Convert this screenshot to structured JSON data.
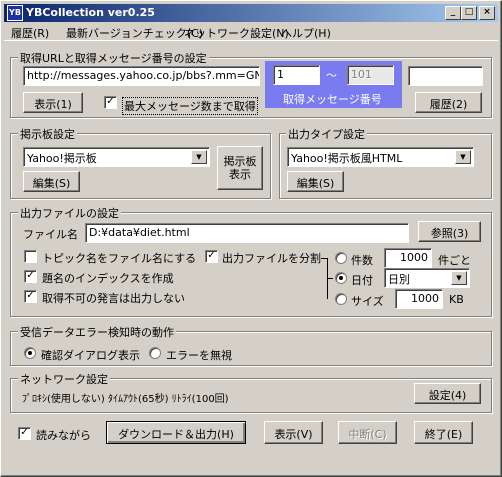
{
  "window": {
    "title": "YBCollection ver0.25",
    "icon_text": "YB"
  },
  "caption_buttons": {
    "minimize": "_",
    "maximize": "□",
    "close": "×"
  },
  "menu": [
    "履歴(R)",
    "最新バージョンチェック(C)",
    "ネットワーク設定(N)",
    "ヘルプ(H)"
  ],
  "url_group": {
    "label": "取得URLと取得メッセージ番号の設定",
    "url": "http://messages.yahoo.co.jp/bbs?.mm=GN&ac",
    "from": "1",
    "tilde": "～",
    "to": "101",
    "range_caption": "取得メッセージ番号",
    "extra": "",
    "show_button": "表示(1)",
    "max_checkbox": "最大メッセージ数まで取得",
    "history_button": "履歴(2)"
  },
  "board_group": {
    "label": "掲示板設定",
    "selected": "Yahoo!掲示板",
    "edit_button": "編集(S)",
    "show_button_line1": "掲示板",
    "show_button_line2": "表示"
  },
  "output_type_group": {
    "label": "出力タイプ設定",
    "selected": "Yahoo!掲示板風HTML",
    "edit_button": "編集(S)"
  },
  "output_file_group": {
    "label": "出力ファイルの設定",
    "filename_label": "ファイル名",
    "filename": "D:¥data¥diet.html",
    "browse_button": "参照(3)",
    "topic_checkbox": "トピック名をファイル名にする",
    "split_checkbox": "出力ファイルを分割",
    "index_checkbox": "題名のインデックスを作成",
    "skip_checkbox": "取得不可の発言は出力しない",
    "count_radio": "件数",
    "count_value": "1000",
    "count_unit": "件ごと",
    "date_radio": "日付",
    "date_selected": "日別",
    "size_radio": "サイズ",
    "size_value": "1000",
    "size_unit": "KB"
  },
  "error_group": {
    "label": "受信データエラー検知時の動作",
    "confirm_radio": "確認ダイアログ表示",
    "ignore_radio": "エラーを無視"
  },
  "network_group": {
    "label": "ネットワーク設定",
    "summary": "ﾌﾟﾛｷｼ(使用しない) ﾀｲﾑｱｳﾄ(65秒) ﾘﾄﾗｲ(100回)",
    "settings_button": "設定(4)"
  },
  "bottom": {
    "read_checkbox": "読みながら",
    "download_button": "ダウンロード＆出力(H)",
    "show_button": "表示(V)",
    "abort_button": "中断(C)",
    "exit_button": "終了(E)"
  },
  "colors": {
    "title_start": "#0a246a",
    "title_end": "#a6caf0",
    "range_box": "#7b7bf0",
    "face": "#d4d0c8"
  }
}
